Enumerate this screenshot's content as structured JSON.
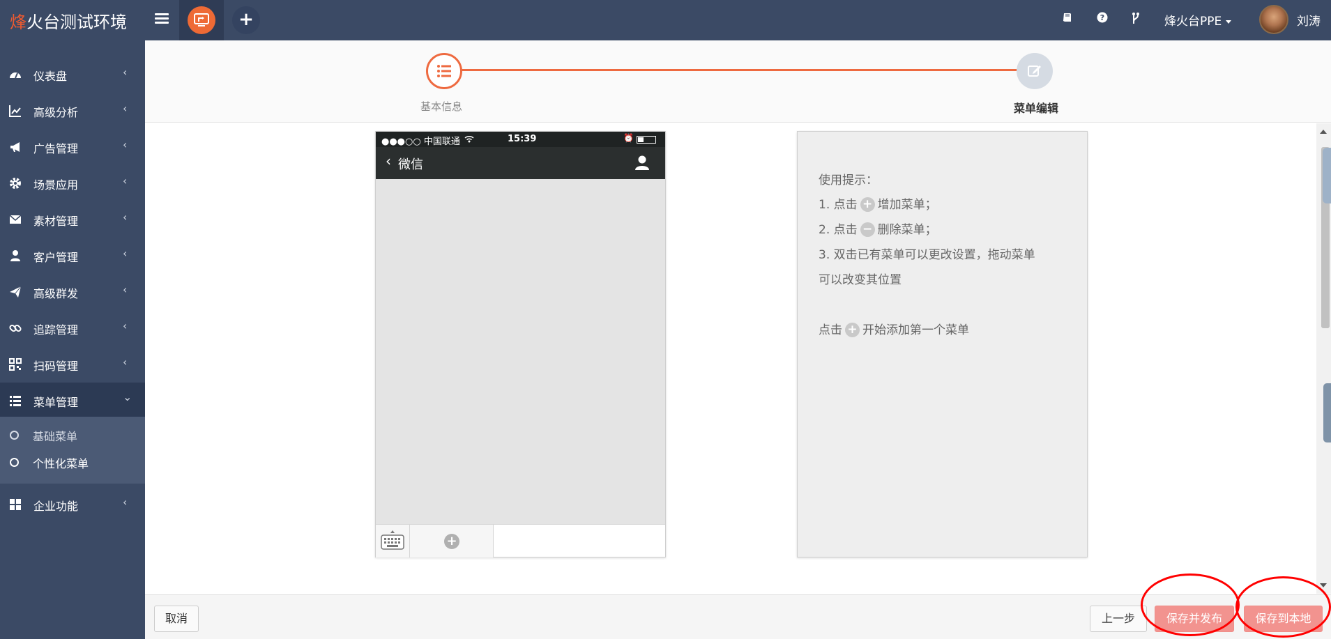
{
  "app": {
    "brand_first_char": "烽",
    "brand_rest": "火台测试环境"
  },
  "topbar": {
    "project_label": "烽火台PPE",
    "username": "刘涛",
    "icons": [
      "book-icon",
      "help-icon",
      "branch-icon"
    ]
  },
  "sidebar": {
    "items": [
      {
        "label": "仪表盘",
        "icon": "dashboard-icon"
      },
      {
        "label": "高级分析",
        "icon": "line-chart-icon"
      },
      {
        "label": "广告管理",
        "icon": "bullhorn-icon"
      },
      {
        "label": "场景应用",
        "icon": "gear-icon"
      },
      {
        "label": "素材管理",
        "icon": "envelope-icon"
      },
      {
        "label": "客户管理",
        "icon": "user-icon"
      },
      {
        "label": "高级群发",
        "icon": "send-icon"
      },
      {
        "label": "追踪管理",
        "icon": "link-icon"
      },
      {
        "label": "扫码管理",
        "icon": "qrcode-icon"
      },
      {
        "label": "菜单管理",
        "icon": "list-icon"
      },
      {
        "label": "企业功能",
        "icon": "grid-icon"
      }
    ],
    "submenu": [
      {
        "label": "基础菜单"
      },
      {
        "label": "个性化菜单"
      }
    ],
    "chevron_collapsed": "‹",
    "chevron_expanded": "⌄"
  },
  "stepper": {
    "step1_label": "基本信息",
    "step2_label": "菜单编辑",
    "accent": "#ee6a40"
  },
  "phone": {
    "carrier": "●●●○○ 中国联通",
    "time": "15:39",
    "title": "微信",
    "back_glyph": "‹"
  },
  "tips": {
    "heading": "使用提示：",
    "line1_prefix": "1. 点击",
    "line1_suffix": "增加菜单；",
    "line2_prefix": "2. 点击",
    "line2_suffix": "删除菜单；",
    "line3a": "3. 双击已有菜单可以更改设置，拖动菜单",
    "line3b": "可以改变其位置",
    "start_prefix": "点击",
    "start_suffix": "开始添加第一个菜单",
    "plus_glyph": "+",
    "minus_glyph": "−"
  },
  "footer": {
    "cancel_label": "取消",
    "prev_label": "上一步",
    "publish_label": "保存并发布",
    "save_local_label": "保存到本地"
  },
  "colors": {
    "sidebar_bg": "#3b4a65",
    "brand_accent": "#ee5a30",
    "primary_button": "#f2938f",
    "annotation": "#ff0000"
  }
}
